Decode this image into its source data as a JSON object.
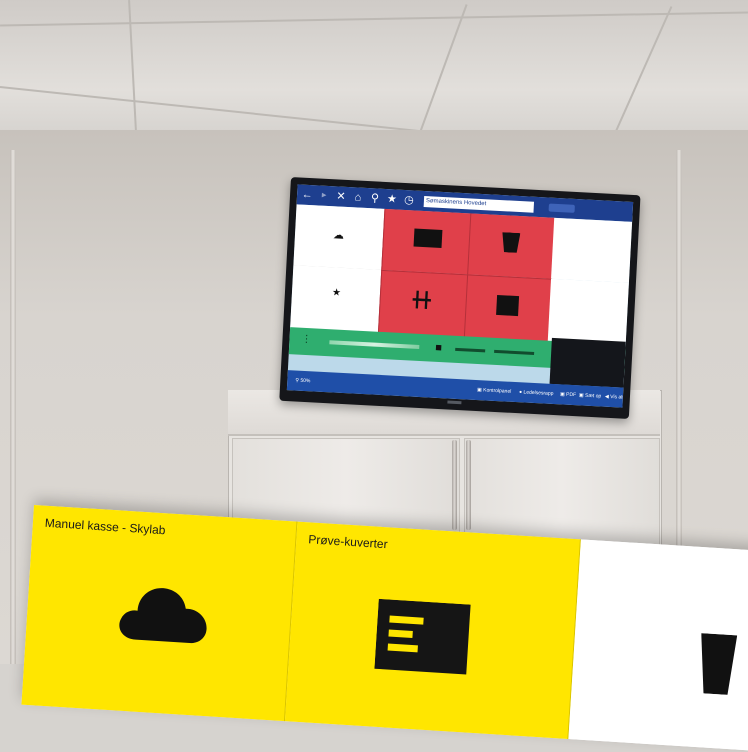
{
  "tv": {
    "toolbar": {
      "icons": [
        "back-arrow-icon",
        "close-icon",
        "home-icon",
        "search-icon",
        "star-icon",
        "clock-icon"
      ],
      "search_value": "Sømaskinens Hovedet"
    },
    "tiles": [
      {
        "color": "#ffffff",
        "icon": "cloud-icon"
      },
      {
        "color": "#e0404a",
        "icon": "envelope-icon"
      },
      {
        "color": "#e0404a",
        "icon": "bin-icon"
      },
      {
        "color": "#ffffff",
        "icon": "star-icon"
      },
      {
        "color": "#e0404a",
        "icon": "tools-icon"
      },
      {
        "color": "#e0404a",
        "icon": "box-icon"
      }
    ],
    "status_color": "#2fae6f",
    "status_icon": "truck-icon",
    "bottom_bar": {
      "zoom": "50%",
      "items": [
        "Kontrolpanel",
        "Ledelsesrapp",
        "PDF",
        "Sæt op",
        "Vis alt"
      ]
    }
  },
  "overlay": {
    "tiles": [
      {
        "label": "Manuel kasse - Skylab",
        "color": "#ffe600",
        "icon": "cloud-icon"
      },
      {
        "label": "Prøve-kuverter",
        "color": "#ffe600",
        "icon": "envelope-icon"
      },
      {
        "label": "",
        "color": "#ffffff",
        "icon": "bin-icon"
      }
    ]
  }
}
